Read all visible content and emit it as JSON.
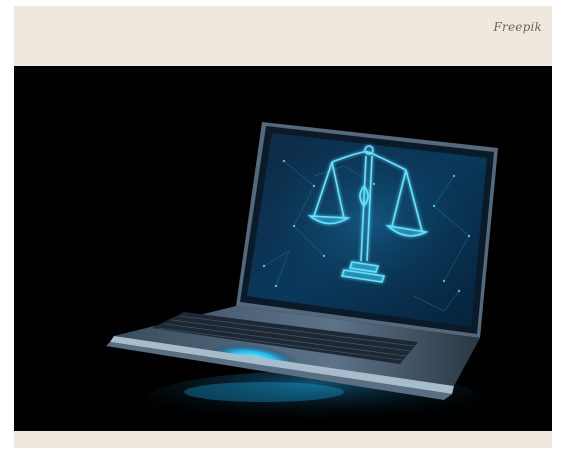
{
  "credit": {
    "text": "Freepik"
  },
  "image": {
    "subject_icon": "scales-of-justice-icon",
    "colors": {
      "background": "#efe8df",
      "photo_background": "#000000",
      "screen_glow": "#3fd8ff",
      "laptop_body": "#7d93a6"
    }
  }
}
